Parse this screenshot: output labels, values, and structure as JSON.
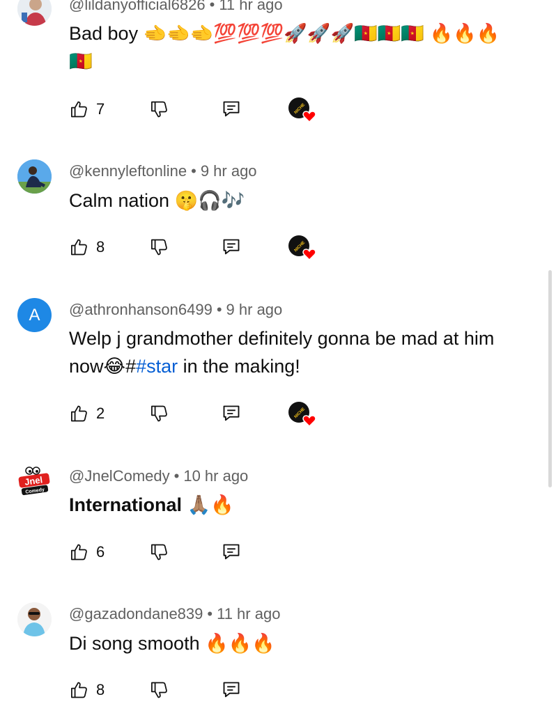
{
  "comments": [
    {
      "author": "@lildanyofficial6826",
      "time": "11 hr ago",
      "text": "Bad boy 🫲🫲🫲💯💯💯🚀🚀🚀🇨🇲🇨🇲🇨🇲 🔥🔥🔥🇨🇲",
      "likes": "7",
      "creator_hearted": true
    },
    {
      "author": "@kennyleftonline",
      "time": "9 hr ago",
      "text": "Calm nation 🤫🎧🎶",
      "likes": "8",
      "creator_hearted": true
    },
    {
      "author": "@athronhanson6499",
      "time": "9 hr ago",
      "avatar_letter": "A",
      "text_before": "Welp j grandmother definitely gonna be mad at him now😂#",
      "hashtag": "#star",
      "text_after": " in the making!",
      "likes": "2",
      "creator_hearted": true
    },
    {
      "author": "@JnelComedy",
      "time": "10 hr ago",
      "avatar_logo_text": "Jnel",
      "avatar_logo_sub": "Comedy",
      "text": "International 🙏🏽🔥",
      "likes": "6",
      "creator_hearted": false
    },
    {
      "author": "@gazadondane839",
      "time": "11 hr ago",
      "text": "Di song smooth 🔥🔥🔥",
      "likes": "8",
      "creator_hearted": false
    }
  ],
  "separator": "•",
  "colors": {
    "meta_gray": "#606060",
    "hashtag_blue": "#065fd4",
    "avatar_a_blue": "#1e88e5",
    "heart_red": "#ff0000"
  },
  "icons": {
    "like": "thumbs-up-icon",
    "dislike": "thumbs-down-icon",
    "reply": "reply-icon",
    "heart": "creator-heart-icon"
  }
}
